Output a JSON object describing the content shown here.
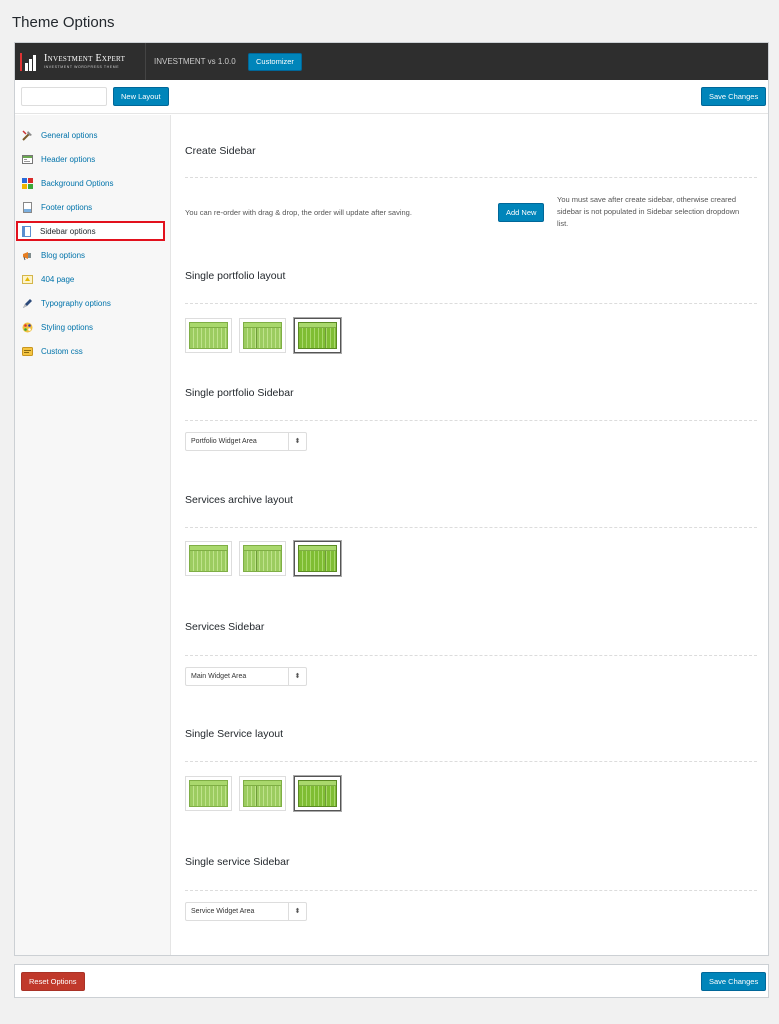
{
  "page": {
    "title": "Theme Options"
  },
  "topbar": {
    "logo_name": "Investment Expert",
    "logo_tagline": "INVESTMENT WORDPRESS THEME",
    "version": "INVESTMENT vs 1.0.0",
    "customizer_label": "Customizer"
  },
  "subbar": {
    "layout_input_value": "",
    "new_layout_label": "New Layout",
    "save_label": "Save Changes"
  },
  "sidebar": {
    "items": [
      {
        "label": "General options",
        "icon": "wrench-icon"
      },
      {
        "label": "Header options",
        "icon": "header-icon"
      },
      {
        "label": "Background Options",
        "icon": "palette-icon"
      },
      {
        "label": "Footer options",
        "icon": "footer-icon"
      },
      {
        "label": "Sidebar options",
        "icon": "sidebar-icon",
        "active": true
      },
      {
        "label": "Blog options",
        "icon": "megaphone-icon"
      },
      {
        "label": "404 page",
        "icon": "warning-icon"
      },
      {
        "label": "Typography options",
        "icon": "pen-icon"
      },
      {
        "label": "Styling options",
        "icon": "styling-icon"
      },
      {
        "label": "Custom css",
        "icon": "css-icon"
      }
    ]
  },
  "content": {
    "create_sidebar": {
      "title": "Create Sidebar",
      "help": "You can re-order with drag & drop, the order will update after saving.",
      "add_new_label": "Add New",
      "description": "You must save after create sidebar, otherwise creared sidebar is not populated in Sidebar selection dropdown list."
    },
    "single_portfolio_layout": {
      "title": "Single portfolio layout",
      "selected_index": 2
    },
    "single_portfolio_sidebar": {
      "title": "Single portfolio Sidebar",
      "value": "Portfolio Widget Area"
    },
    "services_archive_layout": {
      "title": "Services archive layout",
      "selected_index": 2
    },
    "services_sidebar": {
      "title": "Services Sidebar",
      "value": "Main Widget Area"
    },
    "single_service_layout": {
      "title": "Single Service layout",
      "selected_index": 2
    },
    "single_service_sidebar": {
      "title": "Single service Sidebar",
      "value": "Service Widget Area"
    }
  },
  "footer": {
    "reset_label": "Reset Options",
    "save_label": "Save Changes"
  },
  "colors": {
    "accent": "#0085ba",
    "danger": "#c0392b",
    "highlight_border": "#e2111d",
    "topbar": "#2e2e2e"
  }
}
